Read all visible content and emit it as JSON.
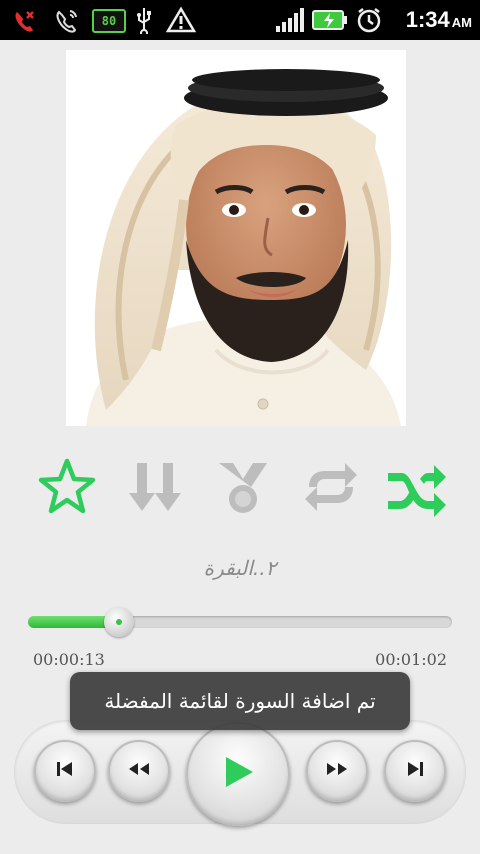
{
  "status_bar": {
    "time": "1:34",
    "ampm": "AM",
    "battery_badge": "80",
    "icons": [
      "missed-call-icon",
      "phone-call-icon",
      "battery-80-badge",
      "usb-icon",
      "warning-icon",
      "signal-icon",
      "battery-charging-icon",
      "alarm-icon"
    ]
  },
  "player": {
    "artist_image": "reciter-portrait",
    "controls": [
      {
        "name": "favorite-star-icon",
        "color": "#2ecc5a",
        "active": true
      },
      {
        "name": "download-icon",
        "color": "#bdbdbd",
        "active": false
      },
      {
        "name": "medal-icon",
        "color": "#bdbdbd",
        "active": false
      },
      {
        "name": "repeat-icon",
        "color": "#bdbdbd",
        "active": false
      },
      {
        "name": "shuffle-icon",
        "color": "#2ecc5a",
        "active": true
      }
    ],
    "track_title": "٢..البقرة",
    "progress": {
      "elapsed": "00:00:13",
      "total": "00:01:02",
      "fraction": 0.21
    },
    "toast": "تم اضافة السورة  لقائمة المفضلة",
    "transport": [
      "previous-icon",
      "rewind-icon",
      "play-icon",
      "fast-forward-icon",
      "next-icon"
    ]
  },
  "colors": {
    "accent": "#2ecc5a",
    "inactive": "#bdbdbd",
    "background": "#ececec"
  }
}
